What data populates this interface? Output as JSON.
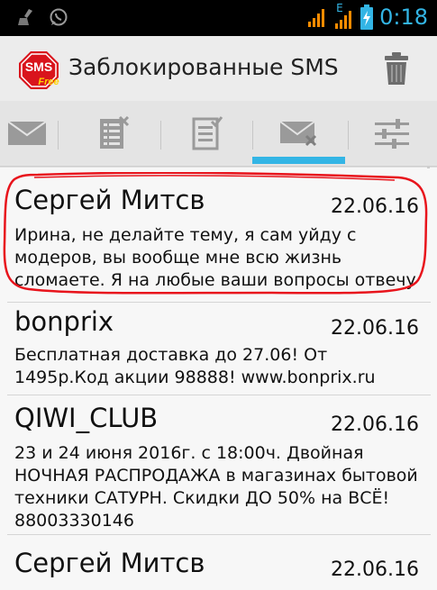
{
  "status_bar": {
    "time": "0:18",
    "network_label": "E",
    "icons": [
      "broom-icon",
      "whatsapp-icon",
      "signal-icon",
      "signal-icon-2",
      "battery-charging-icon"
    ]
  },
  "action_bar": {
    "logo_text": "SMS",
    "logo_subtext": "Free",
    "title": "Заблокированные SMS",
    "delete_icon": "trash-icon"
  },
  "tabs": [
    {
      "icon": "envelope-icon",
      "selected": false
    },
    {
      "icon": "list-blocked-icon",
      "selected": false
    },
    {
      "icon": "list-checked-icon",
      "selected": false
    },
    {
      "icon": "envelope-blocked-icon",
      "selected": true
    },
    {
      "icon": "sliders-icon",
      "selected": false
    }
  ],
  "colors": {
    "accent": "#33b5e5",
    "highlight": "#e8141c"
  },
  "messages": [
    {
      "sender": "Сергей Митсв",
      "date": "22.06.16",
      "text": "Ирина, не делайте тему, я сам уйду с\nмодеров,  вы вообще мне всю жизнь\nсломаете. Я на любые ваши вопросы отвечу"
    },
    {
      "sender": "bonprix",
      "date": "22.06.16",
      "text": "Бесплатная доставка до 27.06! От\n1495р.Код акции 98888! www.bonprix.ru"
    },
    {
      "sender": "QIWI_CLUB",
      "date": "22.06.16",
      "text": "23 и 24 июня 2016г. с 18:00ч. Двойная\nНОЧНАЯ РАСПРОДАЖА в магазинах бытовой\nтехники САТУРН. Скидки ДО 50% на ВСЁ!\n88003330146"
    },
    {
      "sender": "Сергей Митсв",
      "date": "22.06.16",
      "text": ""
    }
  ]
}
